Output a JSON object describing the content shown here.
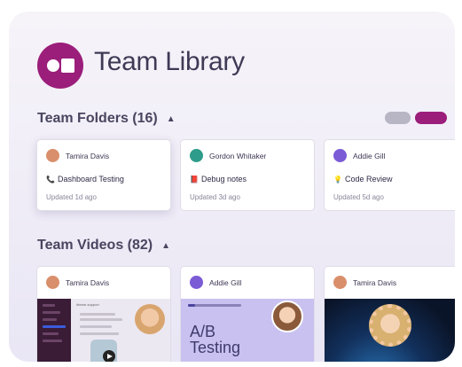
{
  "header": {
    "title": "Team Library",
    "brand_color": "#9b1e7b"
  },
  "folders_section": {
    "title": "Team Folders (16)",
    "caret_icon": "chevron-up-icon",
    "folders": [
      {
        "author": "Tamira Davis",
        "avatar_color": "#d98f6b",
        "emoji": "📞",
        "name": "Dashboard Testing",
        "updated": "Updated 1d ago"
      },
      {
        "author": "Gordon Whitaker",
        "avatar_color": "#2e9c8a",
        "emoji": "📕",
        "name": "Debug notes",
        "updated": "Updated 3d ago"
      },
      {
        "author": "Addie Gill",
        "avatar_color": "#7b5bd6",
        "emoji": "💡",
        "name": "Code Review",
        "updated": "Updated 5d ago"
      }
    ]
  },
  "view_toggle": {
    "off_color": "#b8b6c4",
    "on_color": "#9b1e7b"
  },
  "videos_section": {
    "title": "Team Videos (82)",
    "caret_icon": "chevron-up-icon",
    "videos": [
      {
        "author": "Tamira Davis",
        "avatar_color": "#d98f6b",
        "thumb_label": "#team-support"
      },
      {
        "author": "Addie Gill",
        "avatar_color": "#7b5bd6",
        "thumb_text_1": "A/B",
        "thumb_text_2": "Testing"
      },
      {
        "author": "Tamira Davis",
        "avatar_color": "#d98f6b"
      }
    ]
  }
}
